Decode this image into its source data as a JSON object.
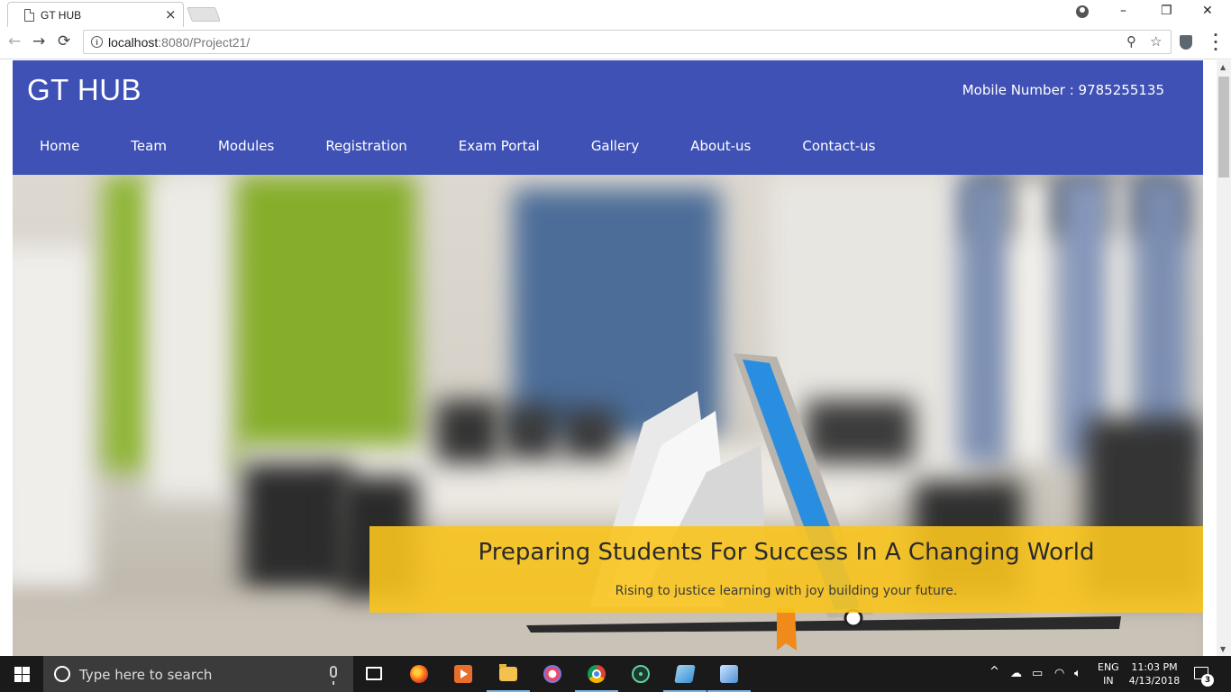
{
  "browser": {
    "tab_title": "GT HUB",
    "tab_close": "×",
    "url_host": "localhost",
    "url_rest": ":8080/Project21/",
    "window_controls": {
      "minimize": "–",
      "maximize": "❐",
      "close": "✕"
    },
    "nav": {
      "back": "←",
      "forward": "→",
      "reload": "⟳"
    },
    "omnibox_icons": {
      "zoom": "⚲",
      "bookmark": "☆"
    }
  },
  "site": {
    "brand": "GT HUB",
    "mobile": "Mobile Number : 9785255135",
    "nav": [
      {
        "label": "Home"
      },
      {
        "label": "Team"
      },
      {
        "label": "Modules"
      },
      {
        "label": "Registration"
      },
      {
        "label": "Exam Portal"
      },
      {
        "label": "Gallery"
      },
      {
        "label": "About-us"
      },
      {
        "label": "Contact-us"
      }
    ],
    "hero": {
      "title": "Preparing Students For Success In A Changing World",
      "subtitle": "Rising to justice learning with joy building your future."
    },
    "colors": {
      "header": "#3f51b5",
      "caption_band": "#f9c41e"
    }
  },
  "taskbar": {
    "search_placeholder": "Type here to search",
    "apps": [
      "task-view",
      "firefox",
      "media-player",
      "file-explorer",
      "paint",
      "chrome",
      "atom",
      "editor",
      "virtualbox"
    ],
    "active_app": "chrome",
    "language": {
      "line1": "ENG",
      "line2": "IN"
    },
    "time": "11:03 PM",
    "date": "4/13/2018",
    "notifications": "3",
    "tray_glyphs": {
      "chevron": "^",
      "wifi": "◠",
      "volume": "🔈︎"
    }
  }
}
